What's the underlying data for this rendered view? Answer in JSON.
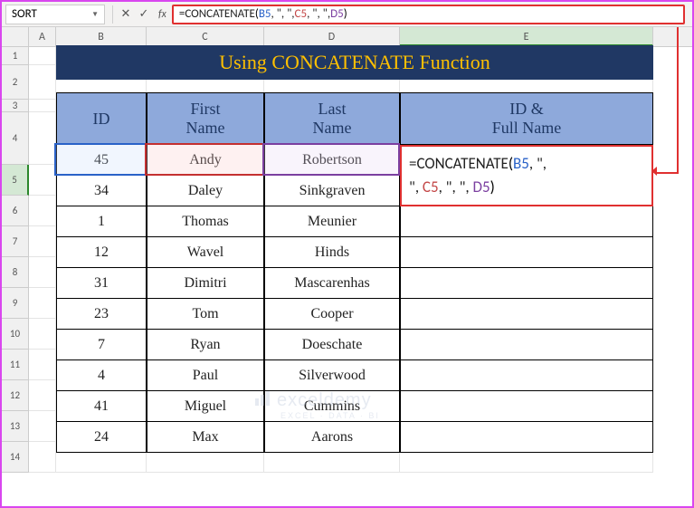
{
  "name_box": "SORT",
  "formula_bar": {
    "eq": "=",
    "func": "CONCATENATE",
    "open": "(",
    "b5": "B5",
    "sep1": ", \", \", ",
    "c5": "C5",
    "sep2": ", \", \", ",
    "d5": "D5",
    "close": ")"
  },
  "columns": [
    "A",
    "B",
    "C",
    "D",
    "E"
  ],
  "row_nums": [
    "1",
    "2",
    "3",
    "4",
    "5",
    "6",
    "7",
    "8",
    "9",
    "10",
    "11",
    "12",
    "13",
    "14"
  ],
  "title": "Using CONCATENATE Function",
  "headers": {
    "id": "ID",
    "first": "First\nName",
    "last": "Last\nName",
    "full": "ID &\nFull Name"
  },
  "rows": [
    {
      "id": "45",
      "first": "Andy",
      "last": "Robertson"
    },
    {
      "id": "34",
      "first": "Daley",
      "last": "Sinkgraven"
    },
    {
      "id": "1",
      "first": "Thomas",
      "last": "Meunier"
    },
    {
      "id": "12",
      "first": "Wavel",
      "last": "Hinds"
    },
    {
      "id": "31",
      "first": "Dimitri",
      "last": "Mascarenhas"
    },
    {
      "id": "23",
      "first": "Tom",
      "last": "Cooper"
    },
    {
      "id": "7",
      "first": "Ryan",
      "last": "Doeschate"
    },
    {
      "id": "4",
      "first": "Paul",
      "last": "Silverwood"
    },
    {
      "id": "41",
      "first": "Miguel",
      "last": "Cummins"
    },
    {
      "id": "24",
      "first": "Max",
      "last": "Aarons"
    }
  ],
  "overlay": {
    "eq": "=",
    "func": "CONCATENATE",
    "open": "(",
    "b5": "B5",
    "txt1": ", \",",
    "txt2": "\", ",
    "c5": "C5",
    "txt3": ", \", \", ",
    "d5": "D5",
    "close": ")"
  },
  "fx": "fx",
  "cancel": "✕",
  "accept": "✓",
  "watermark": {
    "brand": "exceldemy",
    "sub": "EXCEL · DATA · BI"
  }
}
